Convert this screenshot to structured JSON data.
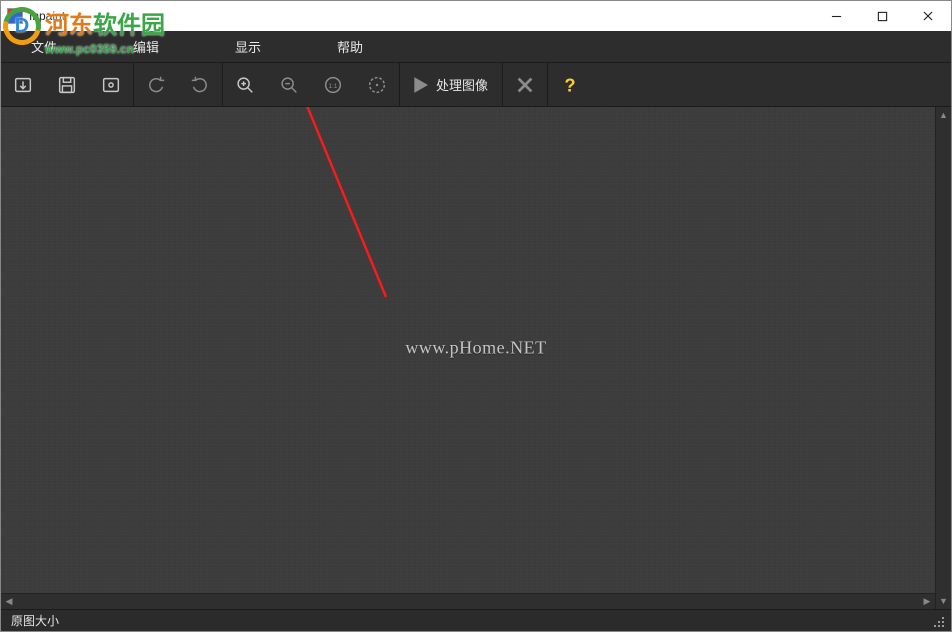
{
  "window": {
    "title": "Inpaint"
  },
  "watermark_top": {
    "text_part1": "河东",
    "text_part2": "软件园",
    "url": "www.pc0359.cn"
  },
  "menubar": {
    "items": [
      {
        "label": "文件"
      },
      {
        "label": "编辑"
      },
      {
        "label": "显示"
      },
      {
        "label": "帮助"
      }
    ]
  },
  "toolbar": {
    "open_label": "打开",
    "save_label": "保存",
    "export_label": "导出",
    "undo_label": "撤销",
    "redo_label": "重做",
    "zoom_in_label": "放大",
    "zoom_out_label": "缩小",
    "zoom_11_label": "1:1",
    "zoom_fit_label": "适合窗口",
    "process_label": "处理图像",
    "cancel_label": "取消",
    "help_label": "帮助"
  },
  "canvas": {
    "center_watermark": "www.pHome.NET"
  },
  "statusbar": {
    "text": "原图大小"
  }
}
